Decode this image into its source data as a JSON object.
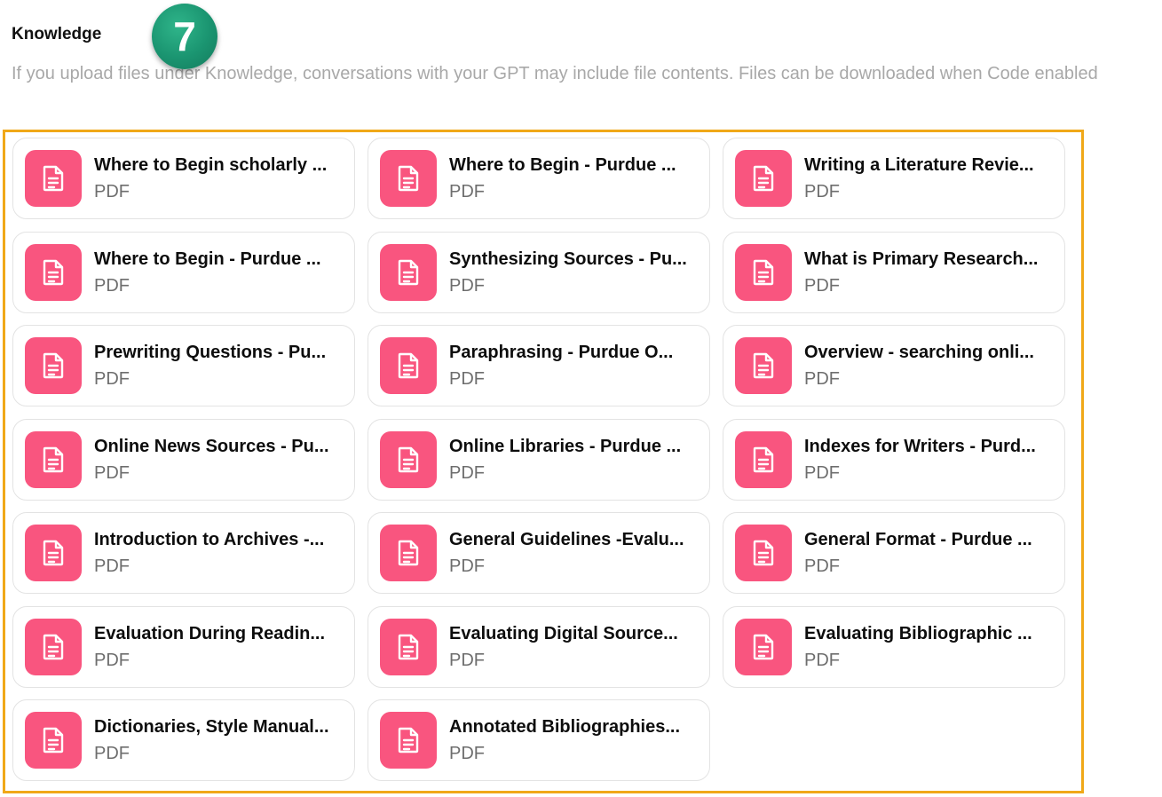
{
  "section": {
    "title": "Knowledge",
    "step_number": "7",
    "description": "If you upload files under Knowledge, conversations with your GPT may include file contents. Files can be downloaded when Code enabled"
  },
  "colors": {
    "file_icon_bg": "#f9557f",
    "highlight_border": "#f0a818",
    "step_badge": "#1a9470"
  },
  "file_icon": "document-icon",
  "files": [
    {
      "name": "Where to Begin scholarly ...",
      "type": "PDF"
    },
    {
      "name": "Where to Begin - Purdue ...",
      "type": "PDF"
    },
    {
      "name": "Writing a Literature Revie...",
      "type": "PDF"
    },
    {
      "name": "Where to Begin - Purdue ...",
      "type": "PDF"
    },
    {
      "name": "Synthesizing Sources - Pu...",
      "type": "PDF"
    },
    {
      "name": "What is Primary Research...",
      "type": "PDF"
    },
    {
      "name": "Prewriting Questions - Pu...",
      "type": "PDF"
    },
    {
      "name": "Paraphrasing - Purdue O...",
      "type": "PDF"
    },
    {
      "name": "Overview - searching onli...",
      "type": "PDF"
    },
    {
      "name": "Online News Sources - Pu...",
      "type": "PDF"
    },
    {
      "name": "Online Libraries - Purdue ...",
      "type": "PDF"
    },
    {
      "name": "Indexes for Writers - Purd...",
      "type": "PDF"
    },
    {
      "name": "Introduction to Archives -...",
      "type": "PDF"
    },
    {
      "name": "General Guidelines -Evalu...",
      "type": "PDF"
    },
    {
      "name": "General Format - Purdue ...",
      "type": "PDF"
    },
    {
      "name": "Evaluation During Readin...",
      "type": "PDF"
    },
    {
      "name": "Evaluating Digital Source...",
      "type": "PDF"
    },
    {
      "name": "Evaluating Bibliographic ...",
      "type": "PDF"
    },
    {
      "name": "Dictionaries, Style Manual...",
      "type": "PDF"
    },
    {
      "name": "Annotated Bibliographies...",
      "type": "PDF"
    }
  ]
}
